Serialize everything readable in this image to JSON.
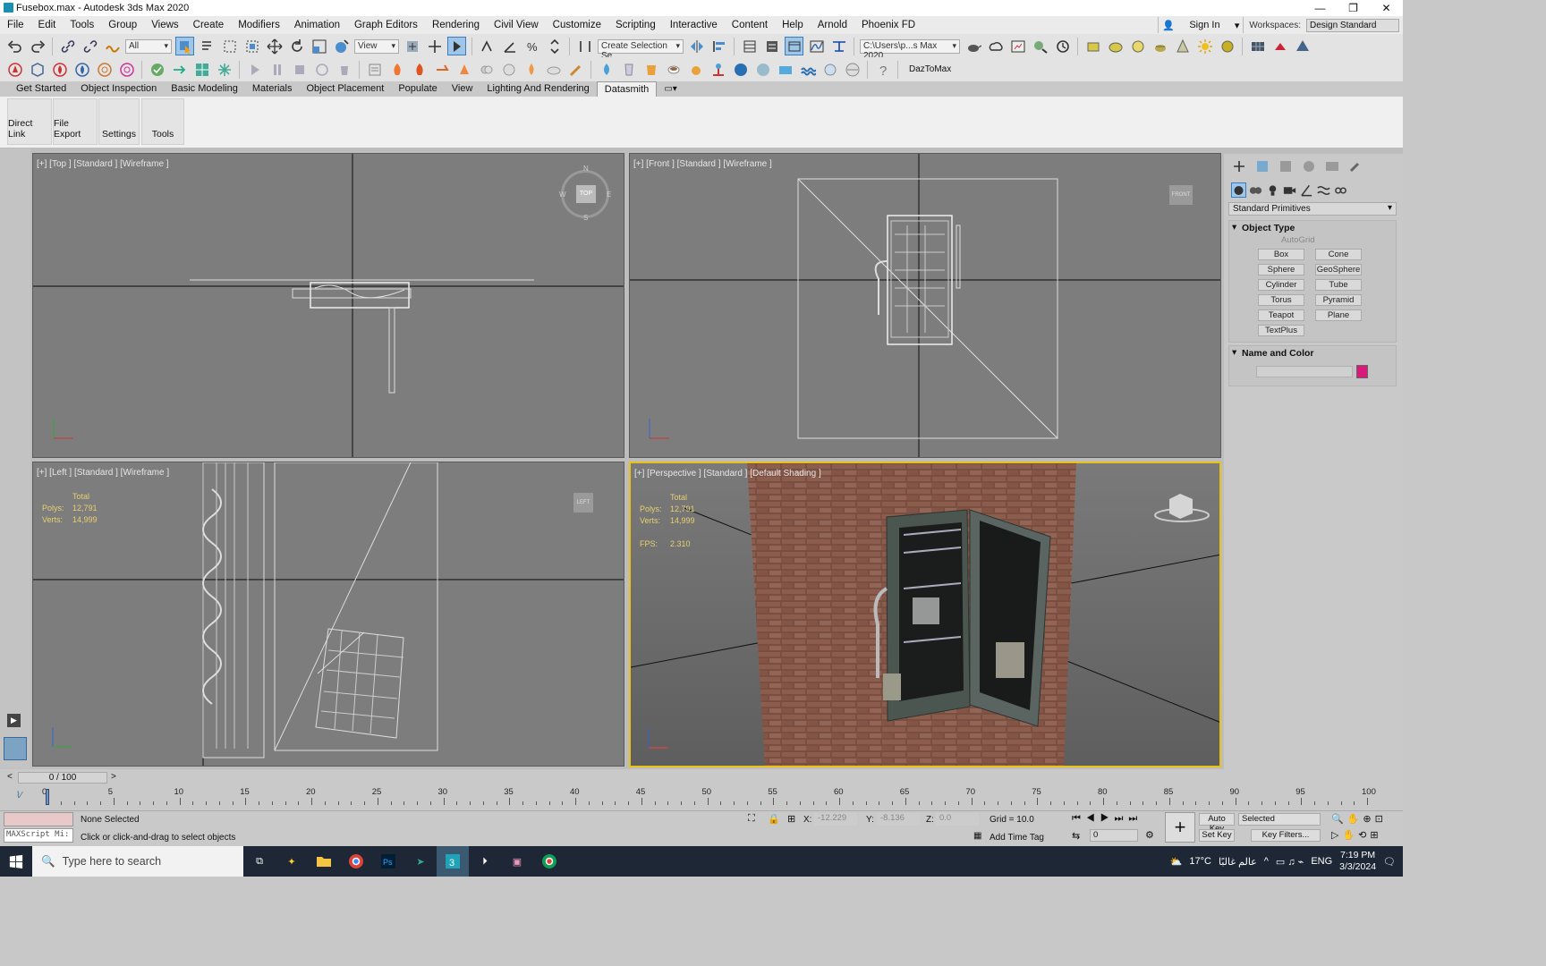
{
  "window": {
    "title": "Fusebox.max - Autodesk 3ds Max 2020",
    "minimize": "—",
    "restore": "❐",
    "close": "✕"
  },
  "menu": [
    "File",
    "Edit",
    "Tools",
    "Group",
    "Views",
    "Create",
    "Modifiers",
    "Animation",
    "Graph Editors",
    "Rendering",
    "Civil View",
    "Customize",
    "Scripting",
    "Interactive",
    "Content",
    "Help",
    "Arnold",
    "Phoenix FD"
  ],
  "account": {
    "sign_in": "Sign In",
    "workspaces_label": "Workspaces:",
    "workspace": "Design Standard"
  },
  "toolbar": {
    "filter": "All",
    "ref_coord": "View",
    "named_selection": "Create Selection Se",
    "project_path": "C:\\Users\\p...s Max 2020",
    "plugin_label": "DazToMax"
  },
  "ribbon_tabs": [
    "Get Started",
    "Object Inspection",
    "Basic Modeling",
    "Materials",
    "Object Placement",
    "Populate",
    "View",
    "Lighting And Rendering",
    "Datasmith"
  ],
  "ribbon_active": "Datasmith",
  "ribbon_panels": [
    "Direct Link",
    "File Export",
    "Settings",
    "Tools"
  ],
  "viewports": {
    "top": {
      "label": "[+] [Top ] [Standard ] [Wireframe ]",
      "cube": "TOP"
    },
    "front": {
      "label": "[+] [Front ] [Standard ] [Wireframe ]",
      "cube": "FRONT"
    },
    "left": {
      "label": "[+] [Left ] [Standard ] [Wireframe ]",
      "cube": "LEFT"
    },
    "perspective": {
      "label": "[+] [Perspective ] [Standard ] [Default Shading ]"
    }
  },
  "stats": {
    "total": "Total",
    "polys_label": "Polys:",
    "polys": "12,791",
    "verts_label": "Verts:",
    "verts": "14,999",
    "fps_label": "FPS:",
    "fps": "2.310"
  },
  "compass": {
    "n": "N",
    "s": "S",
    "e": "E",
    "w": "W"
  },
  "command_panel": {
    "category": "Standard Primitives",
    "object_type_title": "Object Type",
    "autogrid": "AutoGrid",
    "buttons": [
      "Box",
      "Cone",
      "Sphere",
      "GeoSphere",
      "Cylinder",
      "Tube",
      "Torus",
      "Pyramid",
      "Teapot",
      "Plane",
      "TextPlus"
    ],
    "name_color_title": "Name and Color",
    "color": "#d81b7a"
  },
  "timeline": {
    "frame": "0 / 100",
    "ticks": [
      "0",
      "5",
      "10",
      "15",
      "20",
      "25",
      "30",
      "35",
      "40",
      "45",
      "50",
      "55",
      "60",
      "65",
      "70",
      "75",
      "80",
      "85",
      "90",
      "95",
      "100"
    ]
  },
  "status": {
    "selection": "None Selected",
    "prompt": "Click or click-and-drag to select objects",
    "maxscript": "MAXScript Mi:",
    "x_label": "X:",
    "x": "-12.229",
    "y_label": "Y:",
    "y": "-8.136",
    "z_label": "Z:",
    "z": "0.0",
    "grid": "Grid = 10.0",
    "add_time_tag": "Add Time Tag",
    "auto_key": "Auto Key",
    "set_key": "Set Key",
    "key_mode": "Selected",
    "key_filters": "Key Filters...",
    "frame_field": "0"
  },
  "taskbar": {
    "search_placeholder": "Type here to search",
    "temp": "17°C",
    "weather": "عالم غالبًا",
    "lang": "ENG",
    "time": "7:19 PM",
    "date": "3/3/2024"
  }
}
